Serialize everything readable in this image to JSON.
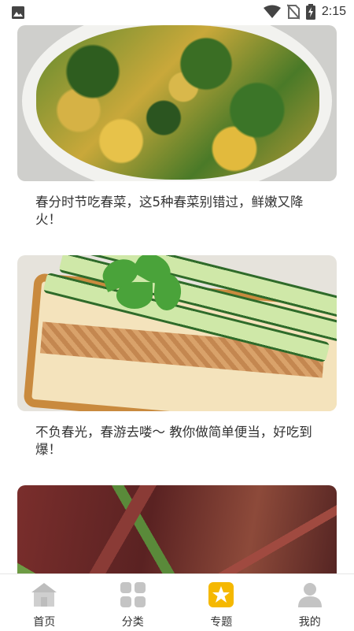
{
  "status_bar": {
    "time": "2:15",
    "icons": [
      "gallery-icon",
      "wifi-icon",
      "no-sim-icon",
      "battery-charging-icon"
    ]
  },
  "feed": {
    "articles": [
      {
        "title": "春分时节吃春菜，这5种春菜别错过，鲜嫩又降火！",
        "image": "spinach-egg-stirfry"
      },
      {
        "title": "不负春光，春游去喽～ 教你做简单便当，好吃到爆！",
        "image": "cucumber-sandwich"
      },
      {
        "title": "",
        "image": "toon-sprouts"
      }
    ]
  },
  "bottom_nav": {
    "active_index": 2,
    "active_color": "#f5b800",
    "inactive_color": "#bdbdbd",
    "items": [
      {
        "label": "首页",
        "icon": "home-icon"
      },
      {
        "label": "分类",
        "icon": "category-grid-icon"
      },
      {
        "label": "专题",
        "icon": "star-badge-icon"
      },
      {
        "label": "我的",
        "icon": "user-icon"
      }
    ]
  }
}
